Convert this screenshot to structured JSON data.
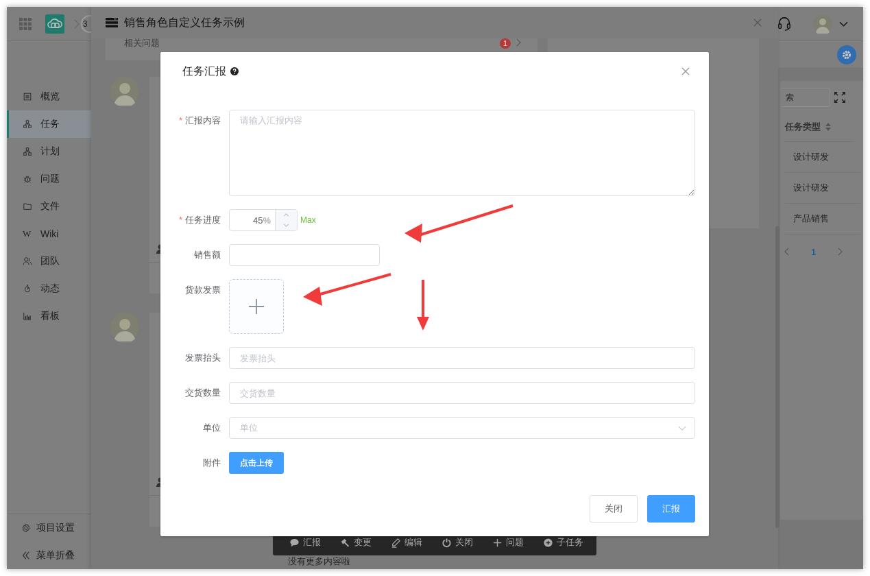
{
  "topbar": {
    "crumb": "3"
  },
  "sidebar": {
    "items": [
      {
        "label": "概览",
        "selected": false
      },
      {
        "label": "任务",
        "selected": true
      },
      {
        "label": "计划",
        "selected": false
      },
      {
        "label": "问题",
        "selected": false
      },
      {
        "label": "文件",
        "selected": false
      },
      {
        "label": "Wiki",
        "selected": false,
        "glyph": "W"
      },
      {
        "label": "团队",
        "selected": false
      },
      {
        "label": "动态",
        "selected": false
      },
      {
        "label": "看板",
        "selected": false
      }
    ],
    "footer": [
      "项目设置",
      "菜单折叠"
    ]
  },
  "table": {
    "search_placeholder": "索",
    "column": "任务类型",
    "rows": [
      "设计研发",
      "设计研发",
      "产品销售"
    ],
    "pagination": [
      {
        "label": "1",
        "selected": true
      }
    ]
  },
  "drawer": {
    "title": "销售角色自定义任务示例",
    "related": {
      "label": "相关问题",
      "count": "1"
    },
    "toolbar": [
      "汇报",
      "变更",
      "编辑",
      "关闭",
      "问题",
      "子任务"
    ],
    "end_note": "没有更多内容啦"
  },
  "modal": {
    "title": "任务汇报",
    "required_mark": "*",
    "fields": [
      {
        "kind": "textarea",
        "label": "汇报内容",
        "required": true,
        "placeholder": "请输入汇报内容"
      },
      {
        "kind": "number",
        "label": "任务进度",
        "required": true,
        "value": "45",
        "unit": "%",
        "hint": "Max"
      },
      {
        "kind": "text",
        "label": "销售额",
        "required": false
      },
      {
        "kind": "upload",
        "label": "货款发票",
        "required": false
      },
      {
        "kind": "text",
        "label": "发票抬头",
        "required": false,
        "placeholder": "发票抬头"
      },
      {
        "kind": "text",
        "label": "交货数量",
        "required": false,
        "placeholder": "交货数量"
      },
      {
        "kind": "select",
        "label": "单位",
        "required": false,
        "placeholder": "单位"
      },
      {
        "kind": "button",
        "label": "附件",
        "required": false,
        "button": "点击上传"
      }
    ],
    "buttons": [
      {
        "label": "关闭",
        "primary": false
      },
      {
        "label": "汇报",
        "primary": true
      }
    ]
  }
}
